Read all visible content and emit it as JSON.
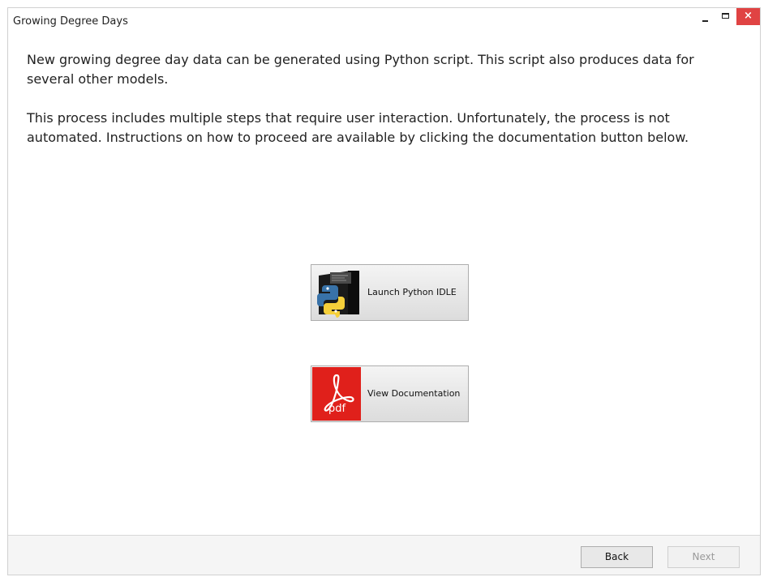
{
  "window": {
    "title": "Growing Degree Days",
    "controls": {
      "minimize": "minimize",
      "maximize": "maximize",
      "close": "×"
    }
  },
  "content": {
    "paragraph1": "New growing degree day data can be generated using Python script. This script also produces data for several other models.",
    "paragraph2": "This process includes multiple steps that require user interaction. Unfortunately, the process is not automated. Instructions on how to proceed are available by clicking the documentation button below."
  },
  "buttons": {
    "launch_python": {
      "label": "Launch Python IDLE",
      "icon": "python-idle-icon"
    },
    "view_docs": {
      "label": "View Documentation",
      "icon": "pdf-icon",
      "icon_text": "pdf"
    }
  },
  "footer": {
    "back_label": "Back",
    "next_label": "Next",
    "next_enabled": false
  },
  "colors": {
    "close_button": "#e04343",
    "pdf_red": "#e0201b",
    "python_blue": "#3872a8",
    "python_yellow": "#f5cf3a"
  }
}
